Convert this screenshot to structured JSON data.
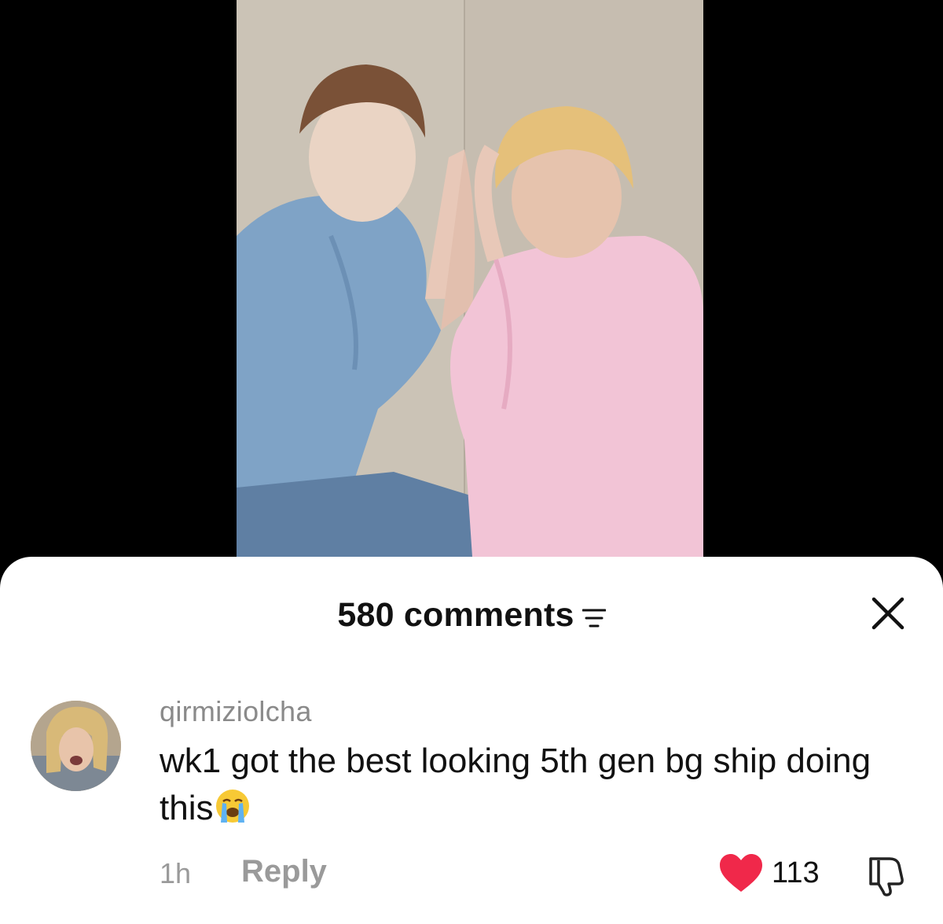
{
  "video": {
    "description_icon": "video-frame"
  },
  "comments_sheet": {
    "count_label": "580 comments",
    "sort_icon": "sort-lines-icon",
    "close_icon": "close-icon"
  },
  "comment": {
    "username": "qirmiziolcha",
    "text": "wk1 got the best looking 5th gen bg ship doing this",
    "emoji": "loudly-crying-face-emoji",
    "time": "1h",
    "reply_label": "Reply",
    "like_count": "113",
    "heart_color": "#f0284a",
    "liked": true
  }
}
